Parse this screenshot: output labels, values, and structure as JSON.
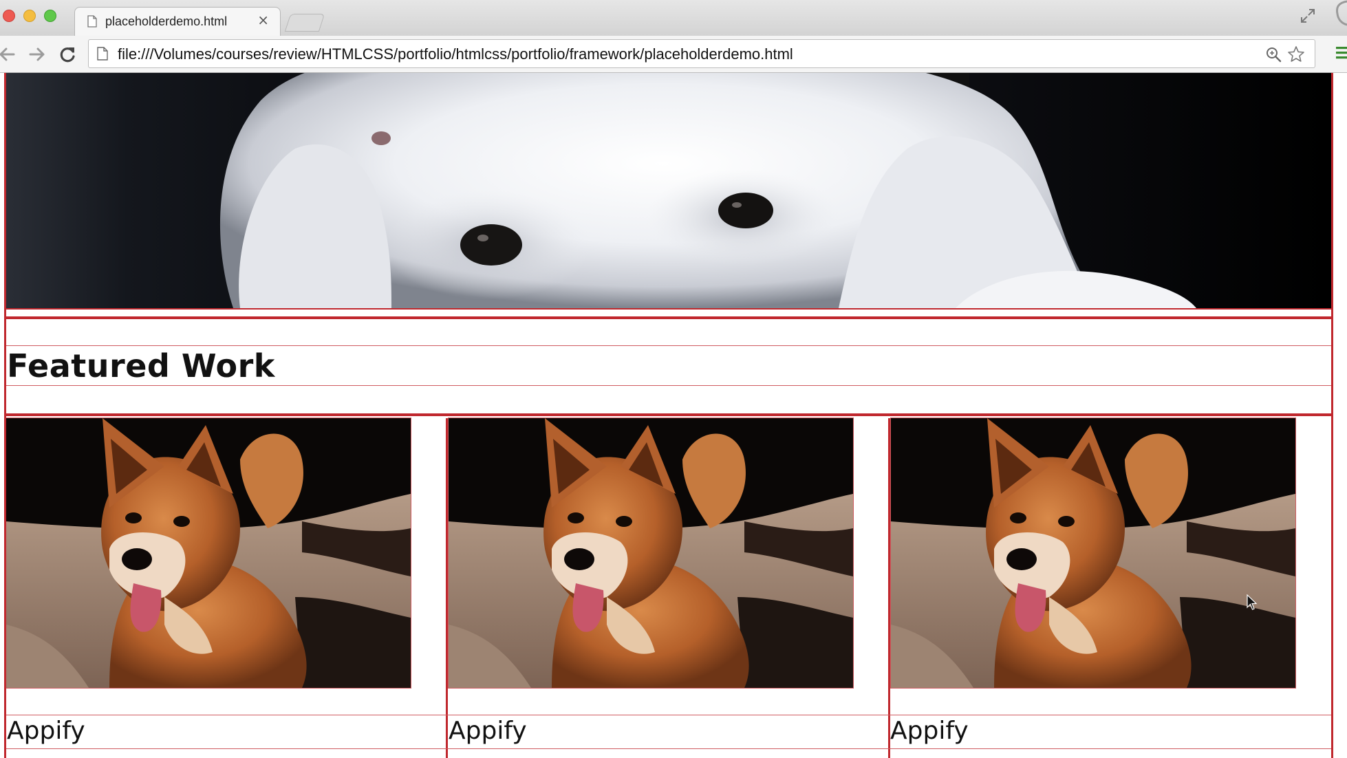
{
  "browser": {
    "tab": {
      "title": "placeholderdemo.html",
      "close_glyph": "×"
    },
    "address_bar": {
      "url": "file:///Volumes/courses/review/HTMLCSS/portfolio/htmlcss/portfolio/framework/placeholderdemo.html"
    },
    "icons": [
      "back-icon",
      "forward-icon",
      "reload-icon",
      "page-icon",
      "zoom-icon",
      "star-icon",
      "menu-icon",
      "fullscreen-icon"
    ]
  },
  "page": {
    "featured": {
      "title": "Featured Work"
    },
    "cards": [
      {
        "label": "Appify"
      },
      {
        "label": "Appify"
      },
      {
        "label": "Appify"
      }
    ]
  },
  "colors": {
    "frame_red": "#c0282e"
  }
}
